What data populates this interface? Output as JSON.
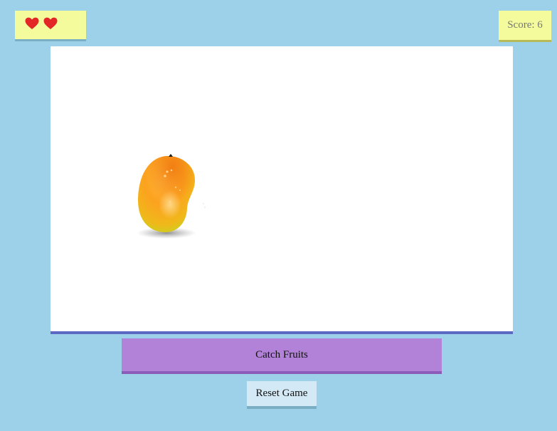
{
  "hud": {
    "lives": {
      "count": 2,
      "icon": "heart-icon",
      "color": "#e32727"
    },
    "score_text": "Score: 6"
  },
  "game": {
    "falling_fruit": {
      "type": "mango",
      "icon": "mango-icon"
    }
  },
  "controls": {
    "catch_label": "Catch Fruits",
    "reset_label": "Reset Game"
  },
  "colors": {
    "background": "#9dd1ea",
    "hud_panel": "#f4fb9c",
    "catch_button": "#b182d8",
    "reset_button": "#d4e9f6",
    "play_area_border": "#5b69c2"
  }
}
